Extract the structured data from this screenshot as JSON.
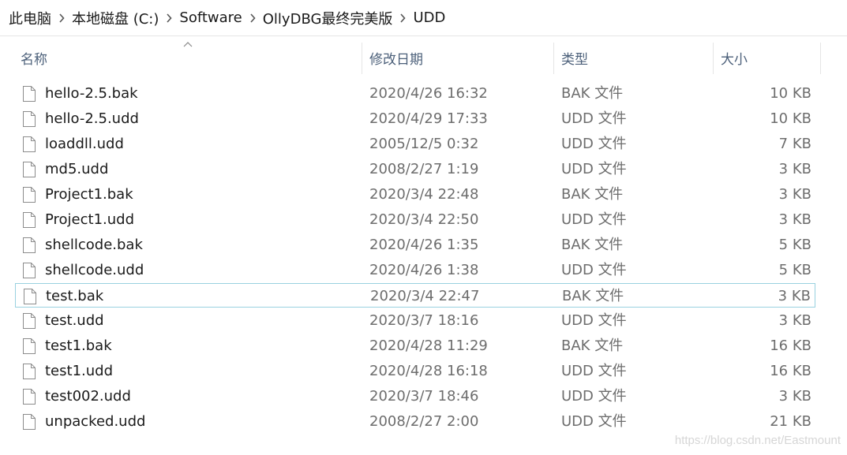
{
  "breadcrumb": {
    "items": [
      "此电脑",
      "本地磁盘 (C:)",
      "Software",
      "OllyDBG最终完美版",
      "UDD"
    ]
  },
  "columns": {
    "name": "名称",
    "date": "修改日期",
    "type": "类型",
    "size": "大小"
  },
  "files": [
    {
      "name": "hello-2.5.bak",
      "date": "2020/4/26 16:32",
      "type": "BAK 文件",
      "size": "10 KB"
    },
    {
      "name": "hello-2.5.udd",
      "date": "2020/4/29 17:33",
      "type": "UDD 文件",
      "size": "10 KB"
    },
    {
      "name": "loaddll.udd",
      "date": "2005/12/5 0:32",
      "type": "UDD 文件",
      "size": "7 KB"
    },
    {
      "name": "md5.udd",
      "date": "2008/2/27 1:19",
      "type": "UDD 文件",
      "size": "3 KB"
    },
    {
      "name": "Project1.bak",
      "date": "2020/3/4 22:48",
      "type": "BAK 文件",
      "size": "3 KB"
    },
    {
      "name": "Project1.udd",
      "date": "2020/3/4 22:50",
      "type": "UDD 文件",
      "size": "3 KB"
    },
    {
      "name": "shellcode.bak",
      "date": "2020/4/26 1:35",
      "type": "BAK 文件",
      "size": "5 KB"
    },
    {
      "name": "shellcode.udd",
      "date": "2020/4/26 1:38",
      "type": "UDD 文件",
      "size": "5 KB"
    },
    {
      "name": "test.bak",
      "date": "2020/3/4 22:47",
      "type": "BAK 文件",
      "size": "3 KB"
    },
    {
      "name": "test.udd",
      "date": "2020/3/7 18:16",
      "type": "UDD 文件",
      "size": "3 KB"
    },
    {
      "name": "test1.bak",
      "date": "2020/4/28 11:29",
      "type": "BAK 文件",
      "size": "16 KB"
    },
    {
      "name": "test1.udd",
      "date": "2020/4/28 16:18",
      "type": "UDD 文件",
      "size": "16 KB"
    },
    {
      "name": "test002.udd",
      "date": "2020/3/7 18:46",
      "type": "UDD 文件",
      "size": "3 KB"
    },
    {
      "name": "unpacked.udd",
      "date": "2008/2/27 2:00",
      "type": "UDD 文件",
      "size": "21 KB"
    }
  ],
  "selected_file": "test.bak",
  "sort": {
    "column": "名称",
    "icon": "sort-up-chevron"
  },
  "file_icon": "blank-file-icon",
  "watermark": "https://blog.csdn.net/Eastmount",
  "colors": {
    "header_text": "#4c607a",
    "selection_border": "#99d1e0",
    "secondary_text": "#6d6d6d"
  }
}
